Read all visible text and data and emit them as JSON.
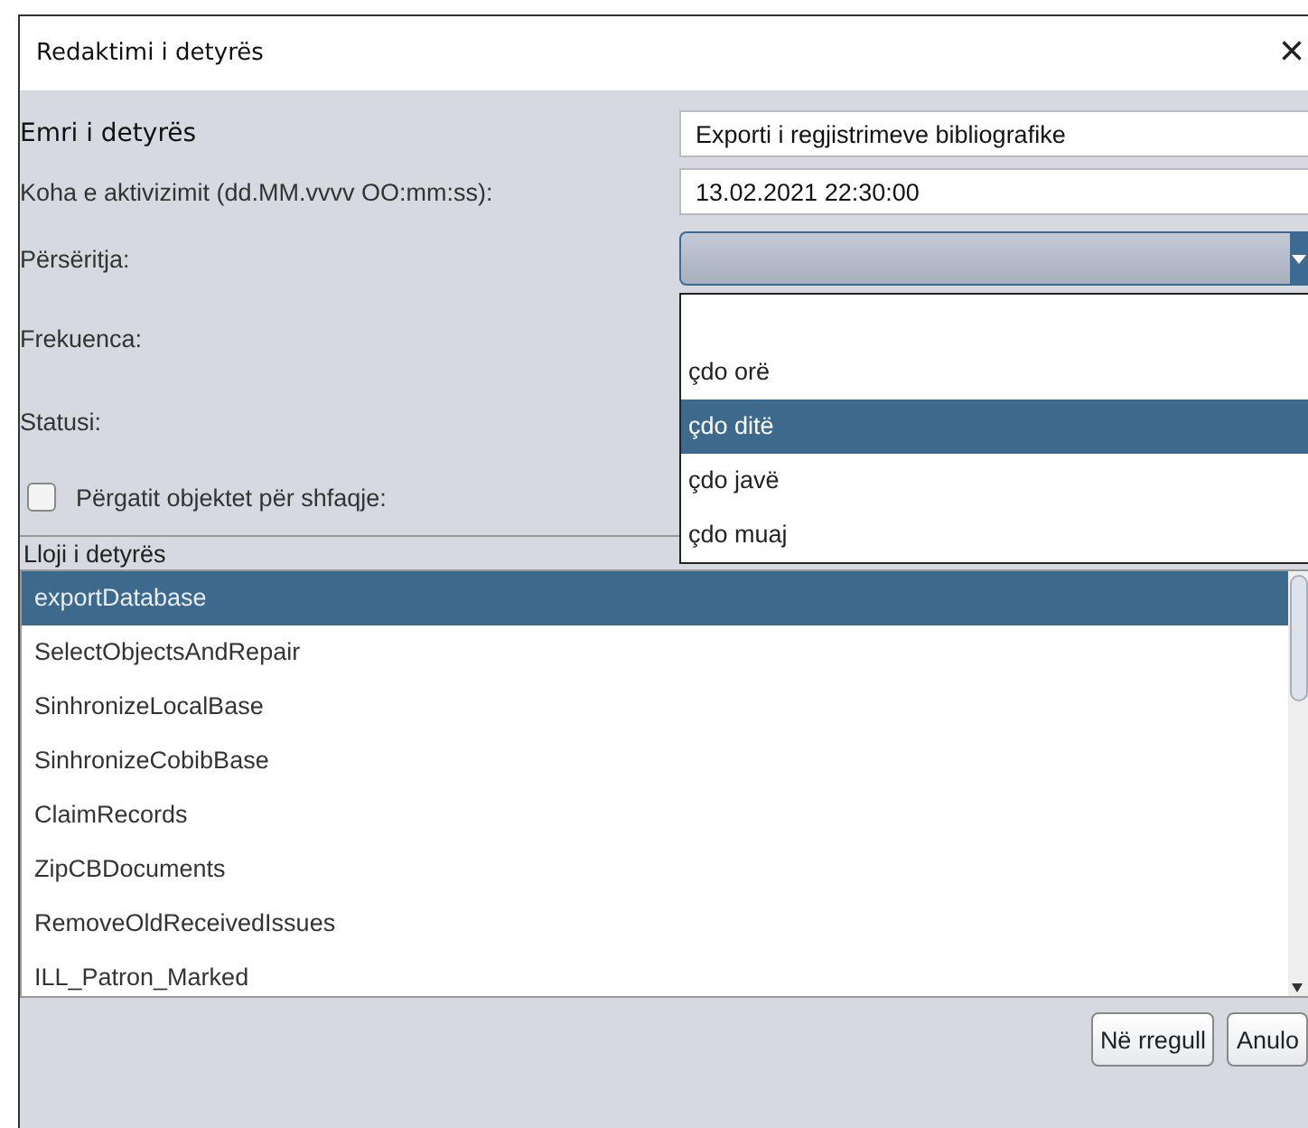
{
  "window": {
    "title": "Redaktimi i detyrës",
    "close": "×"
  },
  "fields": [
    {
      "kind": "text",
      "label": "Emri i detyrës",
      "value": "Exporti i regjistrimeve bibliografike"
    },
    {
      "kind": "text",
      "label": "Koha e aktivizimit (dd.MM.vvvv OO:mm:ss):",
      "value": "13.02.2021 22:30:00"
    },
    {
      "kind": "combo",
      "label": "Përsëritja:",
      "expanded": true,
      "options": [
        {
          "label": "çdo orë",
          "selected": false
        },
        {
          "label": "çdo ditë",
          "selected": true
        },
        {
          "label": "çdo javë",
          "selected": false
        },
        {
          "label": "çdo muaj",
          "selected": false
        }
      ]
    },
    {
      "kind": "hidden",
      "label": "Frekuenca:"
    },
    {
      "kind": "hidden",
      "label": "Statusi:"
    },
    {
      "kind": "checkbox",
      "label": "Përgatit objektet për shfaqje:",
      "checked": false
    }
  ],
  "task_type": {
    "label": "Lloji i detyrës",
    "items": [
      {
        "label": "exportDatabase",
        "selected": true
      },
      {
        "label": "SelectObjectsAndRepair",
        "selected": false
      },
      {
        "label": "SinhronizeLocalBase",
        "selected": false
      },
      {
        "label": "SinhronizeCobibBase",
        "selected": false
      },
      {
        "label": "ClaimRecords",
        "selected": false
      },
      {
        "label": "ZipCBDocuments",
        "selected": false
      },
      {
        "label": "RemoveOldReceivedIssues",
        "selected": false
      },
      {
        "label": "ILL_Patron_Marked",
        "selected": false
      }
    ]
  },
  "buttons": [
    "Në rregull",
    "Anulo"
  ]
}
